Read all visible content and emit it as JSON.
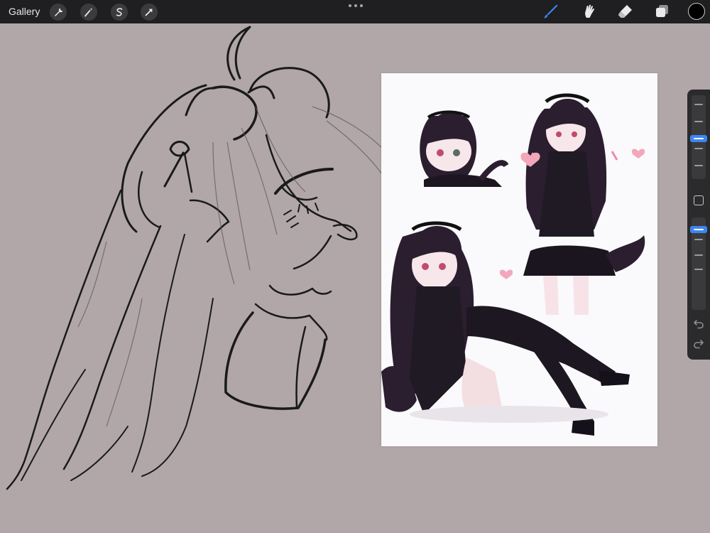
{
  "topbar": {
    "gallery_label": "Gallery",
    "left_tools": [
      "wrench-icon",
      "magic-wand-icon",
      "selection-s-icon",
      "transform-arrow-icon"
    ],
    "right_tools": [
      "brush-icon",
      "smudge-icon",
      "eraser-icon",
      "layers-icon"
    ],
    "active_tool": "brush-icon",
    "current_color": "#000000",
    "accent_color": "#3d86f0"
  },
  "sidebar": {
    "brush_size": 0.28,
    "opacity": 0.58,
    "buttons": [
      "modify-square-icon",
      "undo-icon",
      "redo-icon"
    ]
  },
  "canvas": {
    "background_color": "#b1a7a9",
    "contents": [
      "sketch-drawing",
      "reference-image"
    ]
  }
}
